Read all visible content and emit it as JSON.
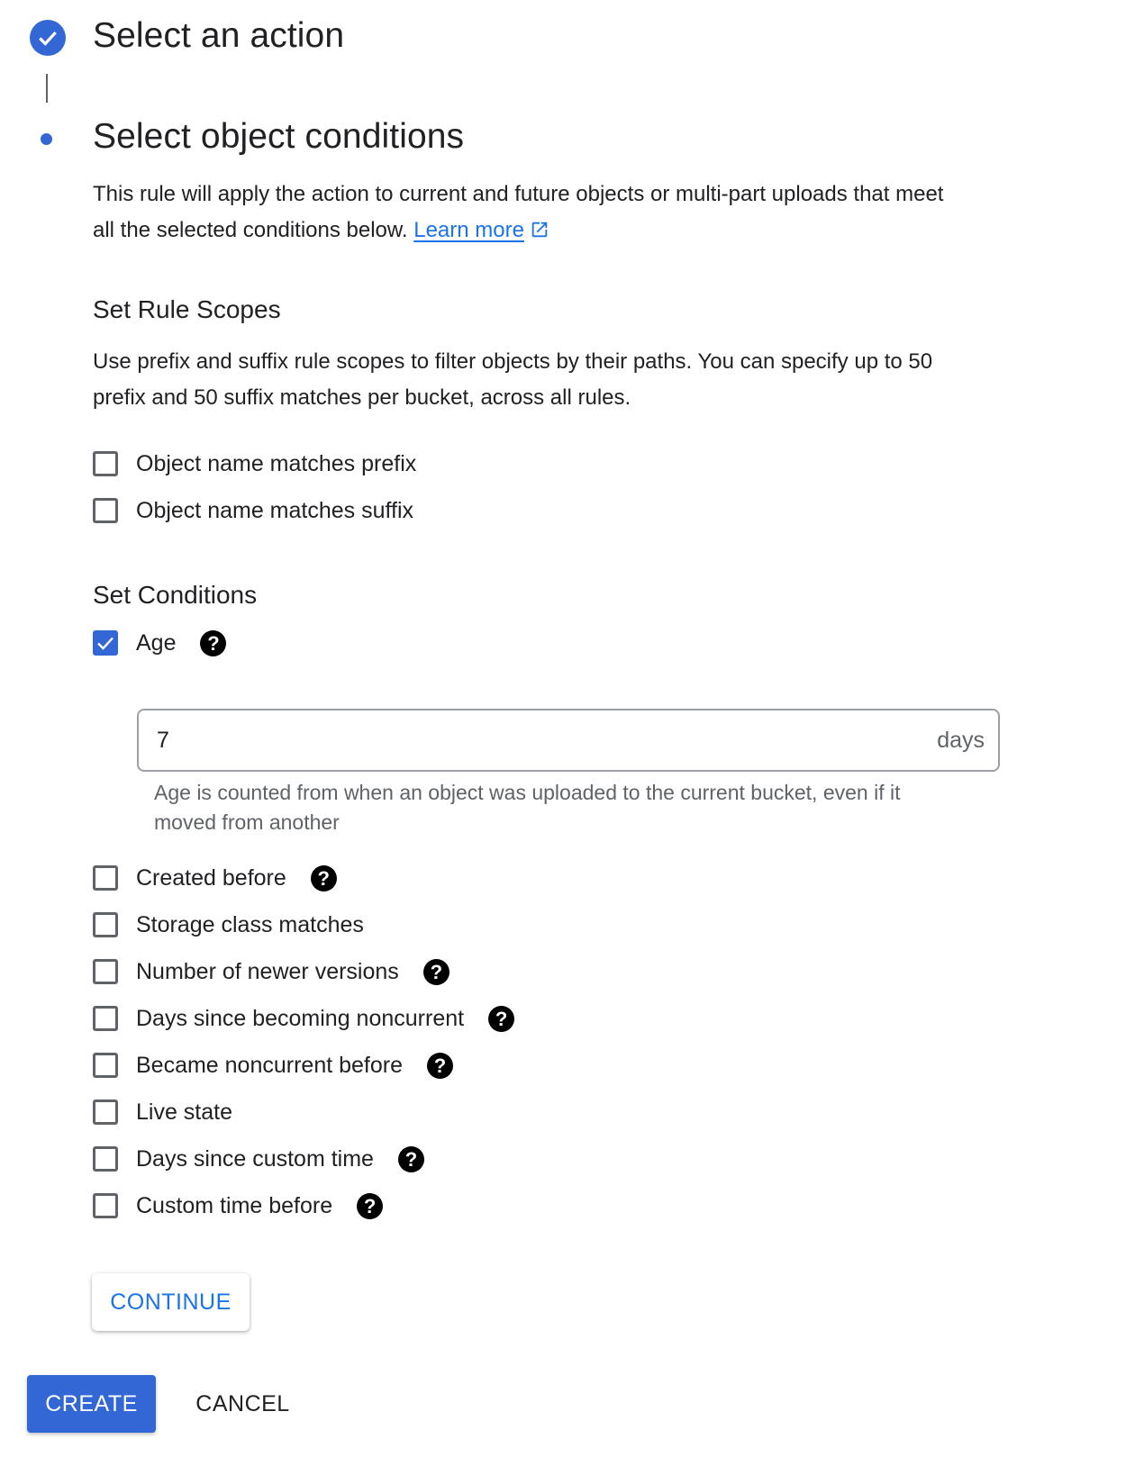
{
  "stepper": {
    "step1": {
      "title": "Select an action",
      "icon": "check-icon",
      "status": "completed"
    },
    "step2": {
      "title": "Select object conditions",
      "description": "This rule will apply the action to current and future objects or multi-part uploads that meet all the selected conditions below.",
      "learn_more": "Learn more",
      "learn_more_icon": "external-link-icon"
    }
  },
  "rule_scopes": {
    "title": "Set Rule Scopes",
    "description": "Use prefix and suffix rule scopes to filter objects by their paths. You can specify up to 50 prefix and 50 suffix matches per bucket, across all rules.",
    "options": [
      {
        "label": "Object name matches prefix",
        "checked": false
      },
      {
        "label": "Object name matches suffix",
        "checked": false
      }
    ]
  },
  "conditions": {
    "title": "Set Conditions",
    "age": {
      "label": "Age",
      "checked": true,
      "help_icon": "help-icon",
      "input_value": "7",
      "input_suffix": "days",
      "hint": "Age is counted from when an object was uploaded to the current bucket, even if it moved from another"
    },
    "options": [
      {
        "label": "Created before",
        "checked": false,
        "help": true
      },
      {
        "label": "Storage class matches",
        "checked": false,
        "help": false
      },
      {
        "label": "Number of newer versions",
        "checked": false,
        "help": true
      },
      {
        "label": "Days since becoming noncurrent",
        "checked": false,
        "help": true
      },
      {
        "label": "Became noncurrent before",
        "checked": false,
        "help": true
      },
      {
        "label": "Live state",
        "checked": false,
        "help": false
      },
      {
        "label": "Days since custom time",
        "checked": false,
        "help": true
      },
      {
        "label": "Custom time before",
        "checked": false,
        "help": true
      }
    ]
  },
  "actions": {
    "continue": "CONTINUE",
    "create": "CREATE",
    "cancel": "CANCEL"
  },
  "colors": {
    "accent": "#3367d6",
    "link": "#1a73e8",
    "text": "#202124",
    "secondary_text": "#5f6368"
  }
}
